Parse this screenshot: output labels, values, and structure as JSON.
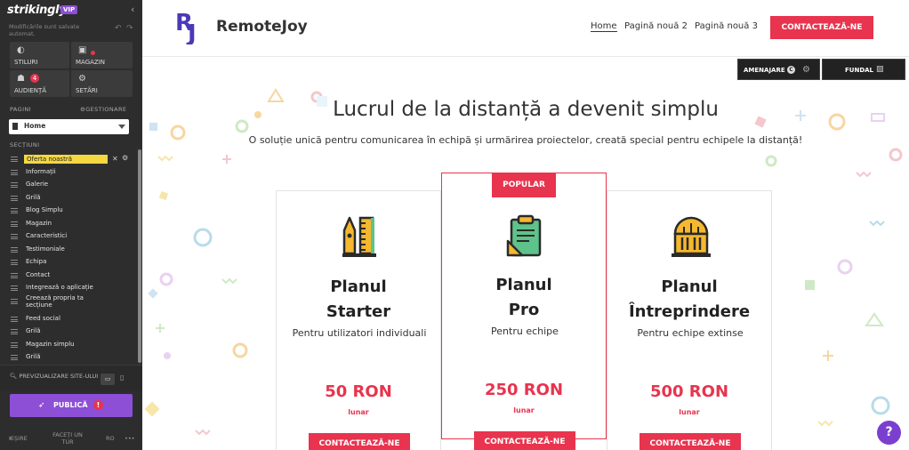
{
  "editor": {
    "logo": "strikingly",
    "vip_badge": "VIP",
    "saved_note": "Modificările sunt salvate automat.",
    "tiles": {
      "styles": "STILURI",
      "store": "MAGAZIN",
      "audience": "AUDIENȚĂ",
      "audience_count": "4",
      "settings": "SETĂRI"
    },
    "pages_label": "PAGINI",
    "manage_label": "GESTIONARE",
    "current_page": "Home",
    "sections_label": "SECȚIUNI",
    "sections": [
      "Oferta noastră",
      "Informații",
      "Galerie",
      "Grilă",
      "Blog Simplu",
      "Magazin",
      "Caracteristici",
      "Testimoniale",
      "Echipa",
      "Contact",
      "Integrează o aplicație",
      "Creează propria ta secțiune",
      "Feed social",
      "Grilă",
      "Magazin simplu",
      "Grilă"
    ],
    "preview_label": "PREVIZUALIZARE SITE-ULUI",
    "publish_label": "PUBLICĂ",
    "publish_warning": "!",
    "footer": {
      "exit": "IEȘIRE",
      "tour": "FACEȚI UN TUR",
      "lang": "RO",
      "more": "•••"
    }
  },
  "site": {
    "brand_initials": "RJ",
    "brand_name": "RemoteJoy",
    "nav": [
      "Home",
      "Pagină nouă 2",
      "Pagină nouă 3"
    ],
    "cta": "CONTACTEAZĂ-NE",
    "edit_layout": "AMENAJARE",
    "edit_layout_badge": "C",
    "edit_background": "FUNDAL",
    "hero_title": "Lucrul de la distanță a devenit simplu",
    "hero_subtitle": "O soluție unică pentru comunicarea în echipă și urmărirea proiectelor, creată special pentru echipele la distanță!",
    "plans": [
      {
        "name_line1": "Planul",
        "name_line2": "Starter",
        "desc": "Pentru utilizatori individuali",
        "price": "50 RON",
        "period": "lunar",
        "button": "CONTACTEAZĂ-NE",
        "icon": "ruler-pen-icon"
      },
      {
        "badge": "POPULAR",
        "name_line1": "Planul",
        "name_line2": "Pro",
        "desc": "Pentru echipe",
        "price": "250 RON",
        "period": "lunar",
        "button": "CONTACTEAZĂ-NE",
        "icon": "clipboard-icon"
      },
      {
        "name_line1": "Planul",
        "name_line2": "Întreprindere",
        "desc": "Pentru echipe extinse",
        "price": "500 RON",
        "period": "lunar",
        "button": "CONTACTEAZĂ-NE",
        "icon": "building-icon"
      }
    ],
    "help": "?"
  },
  "colors": {
    "accent": "#e8344e",
    "brand_purple": "#8c4fd6",
    "sidebar_bg": "#2d2d2d",
    "highlight": "#f5d742"
  }
}
